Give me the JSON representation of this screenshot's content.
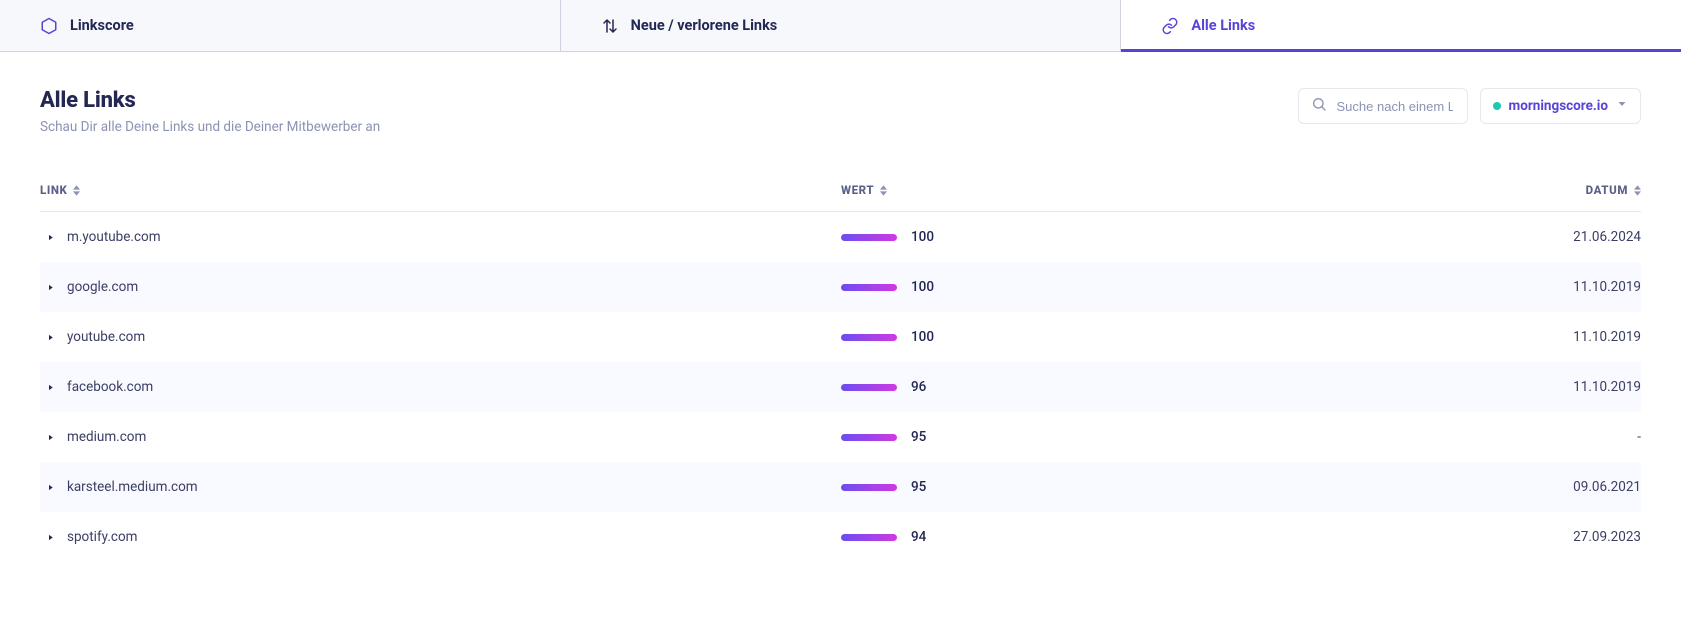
{
  "tabs": {
    "linkscore": "Linkscore",
    "new_lost": "Neue / verlorene Links",
    "all_links": "Alle Links"
  },
  "header": {
    "title": "Alle Links",
    "subtitle": "Schau Dir alle Deine Links und die Deiner Mitbewerber an"
  },
  "search": {
    "placeholder": "Suche nach einem Lir"
  },
  "site_select": {
    "value": "morningscore.io"
  },
  "columns": {
    "link": "LINK",
    "value": "WERT",
    "date": "DATUM"
  },
  "rows": [
    {
      "link": "m.youtube.com",
      "value": 100,
      "date": "21.06.2024"
    },
    {
      "link": "google.com",
      "value": 100,
      "date": "11.10.2019"
    },
    {
      "link": "youtube.com",
      "value": 100,
      "date": "11.10.2019"
    },
    {
      "link": "facebook.com",
      "value": 96,
      "date": "11.10.2019"
    },
    {
      "link": "medium.com",
      "value": 95,
      "date": "-"
    },
    {
      "link": "karsteel.medium.com",
      "value": 95,
      "date": "09.06.2021"
    },
    {
      "link": "spotify.com",
      "value": 94,
      "date": "27.09.2023"
    }
  ]
}
